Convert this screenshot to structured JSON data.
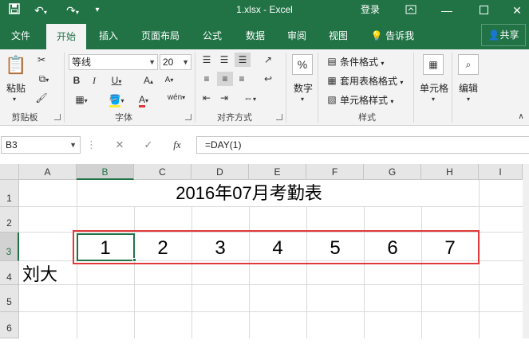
{
  "titlebar": {
    "title": "1.xlsx - Excel",
    "login": "登录",
    "icons": [
      "save-icon",
      "undo-icon",
      "redo-icon",
      "customize-qat-icon",
      "ribbon-display-options-icon",
      "minimize-icon",
      "maximize-icon",
      "close-icon"
    ]
  },
  "tabs": [
    "文件",
    "开始",
    "插入",
    "页面布局",
    "公式",
    "数据",
    "审阅",
    "视图"
  ],
  "tell_me": "告诉我",
  "share": "共享",
  "ribbon": {
    "clipboard": {
      "label": "剪贴板",
      "paste": "粘贴"
    },
    "font": {
      "label": "字体",
      "font_name": "等线",
      "font_size": "20"
    },
    "alignment": {
      "label": "对齐方式"
    },
    "number": {
      "label": "数字",
      "button": "数字"
    },
    "styles": {
      "label": "样式",
      "conditional": "条件格式",
      "table": "套用表格格式",
      "cell_styles": "单元格样式"
    },
    "cells": {
      "button": "单元格"
    },
    "editing": {
      "button": "编辑"
    }
  },
  "formula_bar": {
    "name_box": "B3",
    "fx": "fx",
    "formula": "=DAY(1)"
  },
  "sheet": {
    "columns": [
      "A",
      "B",
      "C",
      "D",
      "E",
      "F",
      "G",
      "H",
      "I"
    ],
    "rows": [
      "1",
      "2",
      "3",
      "4",
      "5",
      "6"
    ],
    "selected_column": "B",
    "selected_row": "3",
    "title_cell": "2016年07月考勤表",
    "days": [
      "1",
      "2",
      "3",
      "4",
      "5",
      "6",
      "7"
    ],
    "name_cell": "刘大"
  },
  "colors": {
    "excel_green": "#217346",
    "highlight_red": "#e03a3a"
  }
}
